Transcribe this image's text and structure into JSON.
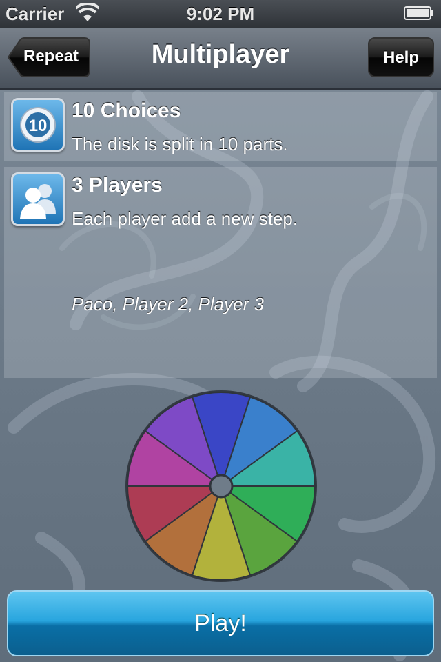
{
  "status_bar": {
    "carrier": "Carrier",
    "time": "9:02 PM"
  },
  "nav": {
    "title": "Multiplayer",
    "back_label": "Repeat",
    "help_label": "Help"
  },
  "options": {
    "choices": {
      "icon_text": "10",
      "title": "10 Choices",
      "description": "The disk is split in 10 parts."
    },
    "players": {
      "title": "3 Players",
      "description": "Each player add a new step.",
      "names": "Paco, Player 2, Player 3"
    }
  },
  "wheel": {
    "segments": 10,
    "colors": [
      "#3a46c6",
      "#3a80cc",
      "#3ab3a6",
      "#2fae58",
      "#5aa43e",
      "#b2b23c",
      "#b2703c",
      "#ad3c54",
      "#b043a2",
      "#7e4ac6"
    ]
  },
  "play_label": "Play!",
  "icons": {
    "choices": "ten-badge-icon",
    "players": "players-icon",
    "wifi": "wifi-icon",
    "battery": "battery-icon"
  }
}
